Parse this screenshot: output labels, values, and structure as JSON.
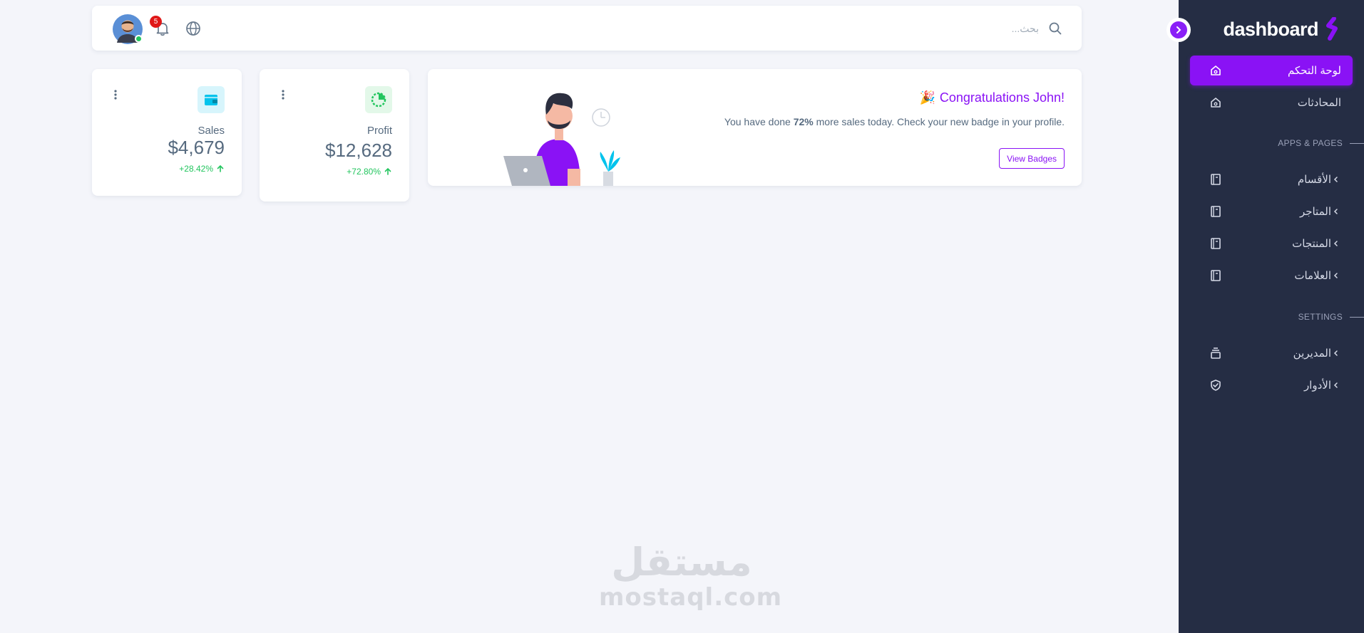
{
  "sidebar": {
    "brand": "dashboard",
    "items_main": [
      {
        "label": "لوحة التحكم",
        "icon": "home-icon",
        "active": true
      },
      {
        "label": "المحادثات",
        "icon": "home-icon",
        "active": false
      }
    ],
    "section_apps": "APPS & PAGES",
    "items_apps": [
      {
        "label": "الأقسام",
        "icon": "book-icon"
      },
      {
        "label": "المتاجر",
        "icon": "book-icon"
      },
      {
        "label": "المنتجات",
        "icon": "book-icon"
      },
      {
        "label": "العلامات",
        "icon": "book-icon"
      }
    ],
    "section_settings": "SETTINGS",
    "items_settings": [
      {
        "label": "المديرين",
        "icon": "stack-icon"
      },
      {
        "label": "الأدوار",
        "icon": "shield-check-icon"
      }
    ]
  },
  "navbar": {
    "search_placeholder": "بحث...",
    "notification_count": "5",
    "accent": "#8a12f5"
  },
  "congrats": {
    "title": "Congratulations John!",
    "emoji": "🎉",
    "text_before": "You have done ",
    "highlight": "72%",
    "text_after": " more sales today. Check your new badge in your profile.",
    "button": "View Badges"
  },
  "stats": {
    "profit": {
      "label": "Profit",
      "value": "$12,628",
      "change": "+72.80%",
      "icon": "pie-chart-icon",
      "color": "#22c55e"
    },
    "sales": {
      "label": "Sales",
      "value": "$4,679",
      "change": "+28.42%",
      "icon": "wallet-icon",
      "color": "#03c3ec"
    }
  },
  "watermark": {
    "arabic": "مستقل",
    "latin": "mostaql.com"
  }
}
